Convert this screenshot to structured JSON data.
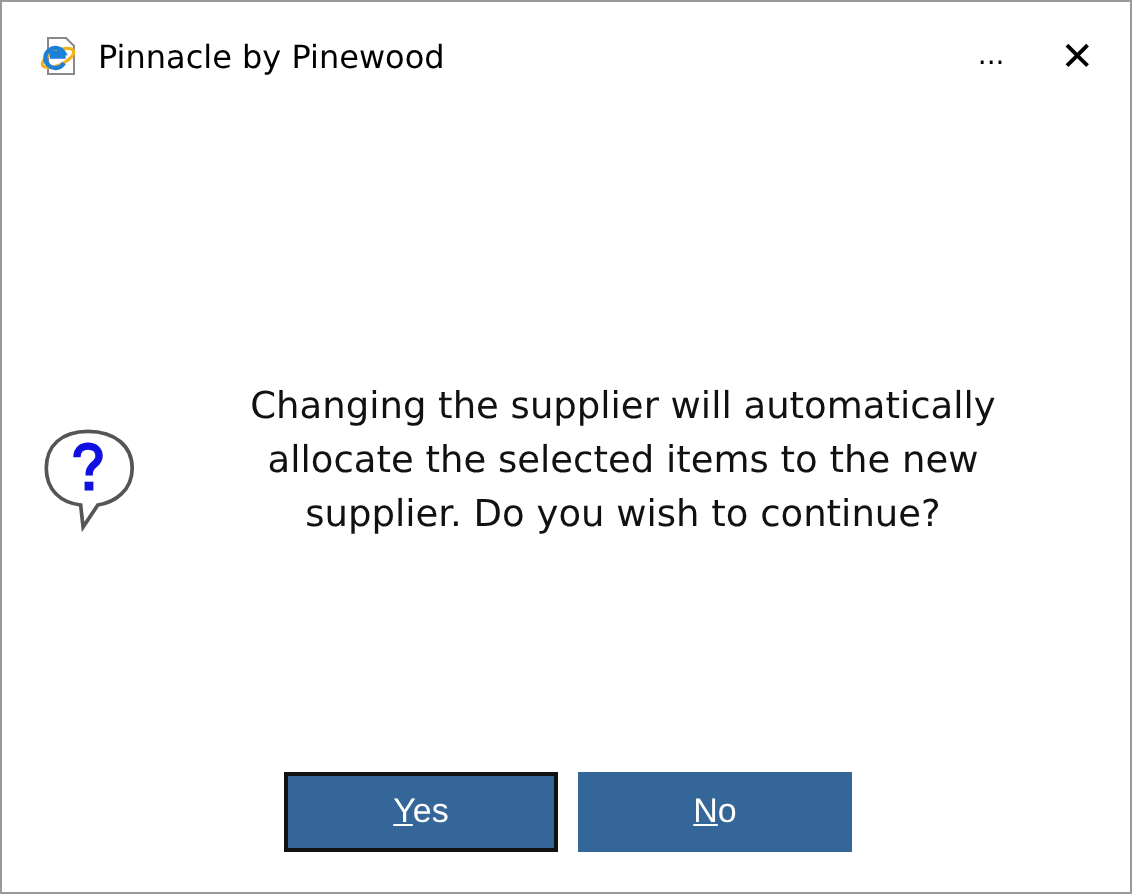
{
  "window": {
    "title": "Pinnacle by Pinewood",
    "menu": "...",
    "close": "✕"
  },
  "message": "Changing the supplier will automatically allocate the selected items to the new supplier. Do you wish to continue?",
  "buttons": [
    {
      "label": "Yes",
      "focused": true
    },
    {
      "label": "No",
      "focused": false
    }
  ]
}
